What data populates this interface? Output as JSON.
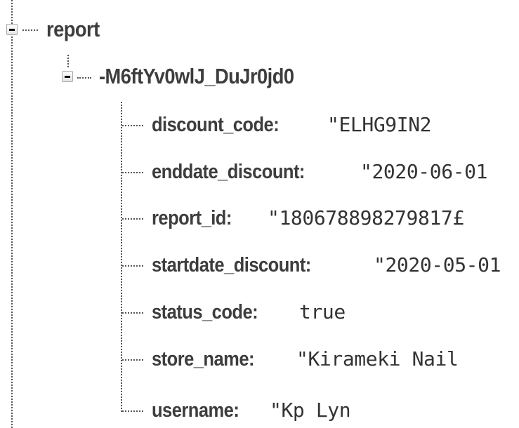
{
  "tree": {
    "root": {
      "name": "report",
      "expanded": true
    },
    "child": {
      "name": "-M6ftYv0wlJ_DuJr0jd0",
      "expanded": true
    },
    "fields": [
      {
        "key": "discount_code:",
        "value": "\"ELHG9IN2"
      },
      {
        "key": "enddate_discount:",
        "value": "\"2020-06-01"
      },
      {
        "key": "report_id:",
        "value": "\"180678898279817£"
      },
      {
        "key": "startdate_discount:",
        "value": "\"2020-05-01"
      },
      {
        "key": "status_code:",
        "value": "true"
      },
      {
        "key": "store_name:",
        "value": "\"Kirameki Nail"
      },
      {
        "key": "username:",
        "value": "\"Kp Lyn"
      }
    ]
  },
  "icons": {
    "toggle": "minus-icon"
  }
}
